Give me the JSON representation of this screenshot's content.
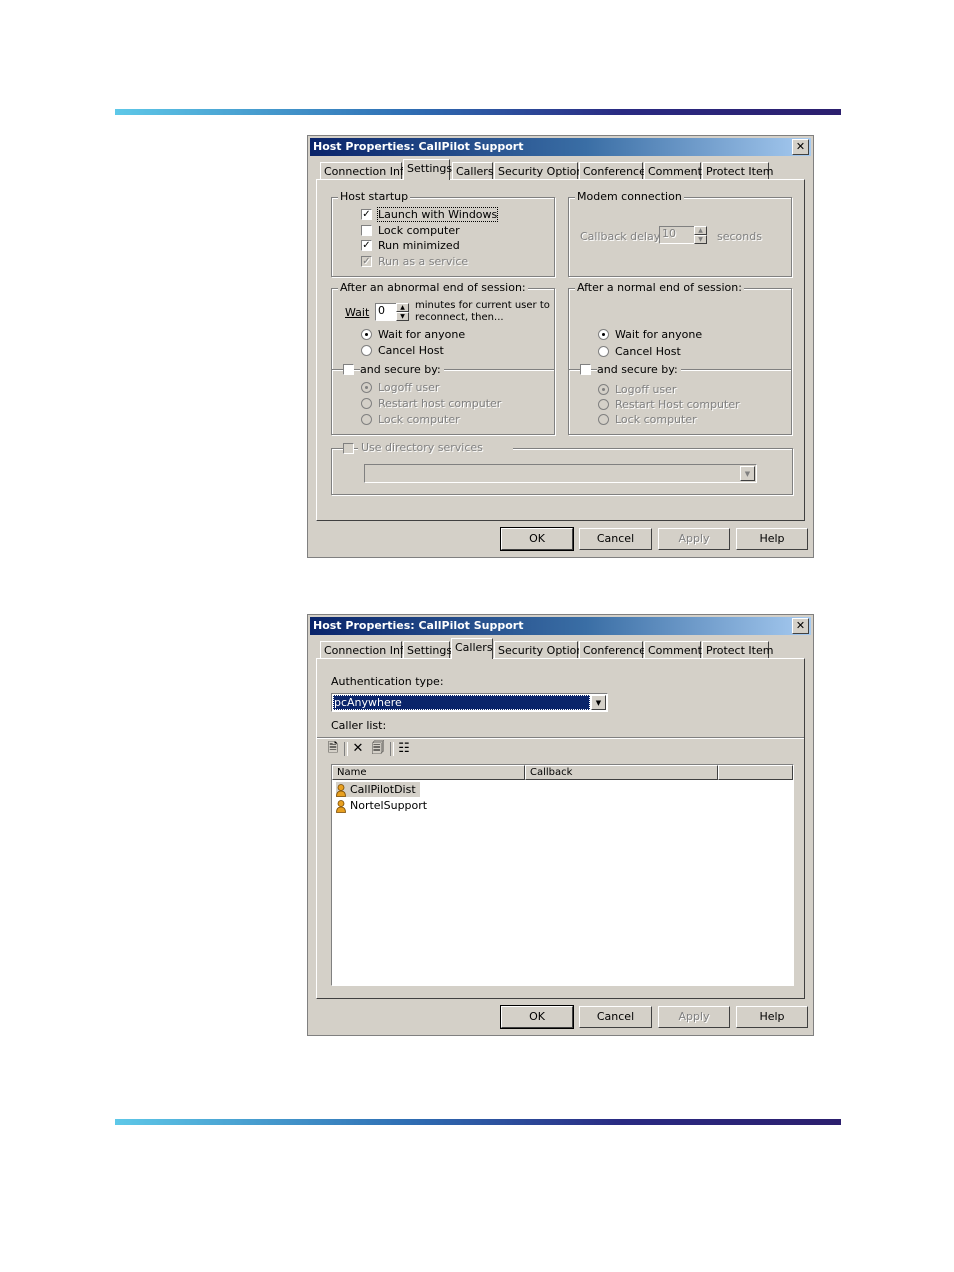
{
  "dialog1": {
    "title": "Host Properties: CallPilot Support",
    "tabs": [
      "Connection Info",
      "Settings",
      "Callers",
      "Security Options",
      "Conference",
      "Comments",
      "Protect Item"
    ],
    "host_startup": {
      "legend": "Host startup",
      "launch_with_windows": {
        "label": "Launch with Windows",
        "checked": true
      },
      "lock_computer": {
        "label": "Lock computer",
        "checked": false
      },
      "run_minimized": {
        "label": "Run minimized",
        "checked": true
      },
      "run_as_service": {
        "label": "Run as a service",
        "checked": true,
        "disabled": true
      }
    },
    "modem": {
      "legend": "Modem connection",
      "callback_label": "Callback delay:",
      "callback_value": "10",
      "seconds_label": "seconds"
    },
    "abnormal": {
      "legend": "After an abnormal end of session:",
      "wait_label": "Wait",
      "wait_value": "0",
      "wait_text_1": "minutes for current user to",
      "wait_text_2": "reconnect, then...",
      "wait_for_anyone": "Wait for anyone",
      "cancel_host": "Cancel Host",
      "and_secure_by": "and secure by:",
      "logoff_user": "Logoff user",
      "restart_host": "Restart host computer",
      "lock_computer": "Lock computer"
    },
    "normal": {
      "legend": "After a normal end of session:",
      "wait_for_anyone": "Wait for anyone",
      "cancel_host": "Cancel Host",
      "and_secure_by": "and secure by:",
      "logoff_user": "Logoff user",
      "restart_host": "Restart Host computer",
      "lock_computer": "Lock computer"
    },
    "directory": {
      "label": "Use directory services"
    },
    "buttons": {
      "ok": "OK",
      "cancel": "Cancel",
      "apply": "Apply",
      "help": "Help"
    }
  },
  "dialog2": {
    "title": "Host Properties: CallPilot Support",
    "tabs": [
      "Connection Info",
      "Settings",
      "Callers",
      "Security Options",
      "Conference",
      "Comments",
      "Protect Item"
    ],
    "auth_label": "Authentication type:",
    "auth_value": "pcAnywhere",
    "caller_list_label": "Caller list:",
    "columns": [
      "Name",
      "Callback",
      ""
    ],
    "callers": [
      "CallPilotDist",
      "NortelSupport"
    ],
    "buttons": {
      "ok": "OK",
      "cancel": "Cancel",
      "apply": "Apply",
      "help": "Help"
    }
  },
  "colors": {
    "accent": "#0a246a",
    "face": "#d4d0c8",
    "rule_start": "#5ec8e8",
    "rule_end": "#2c1f6e"
  }
}
